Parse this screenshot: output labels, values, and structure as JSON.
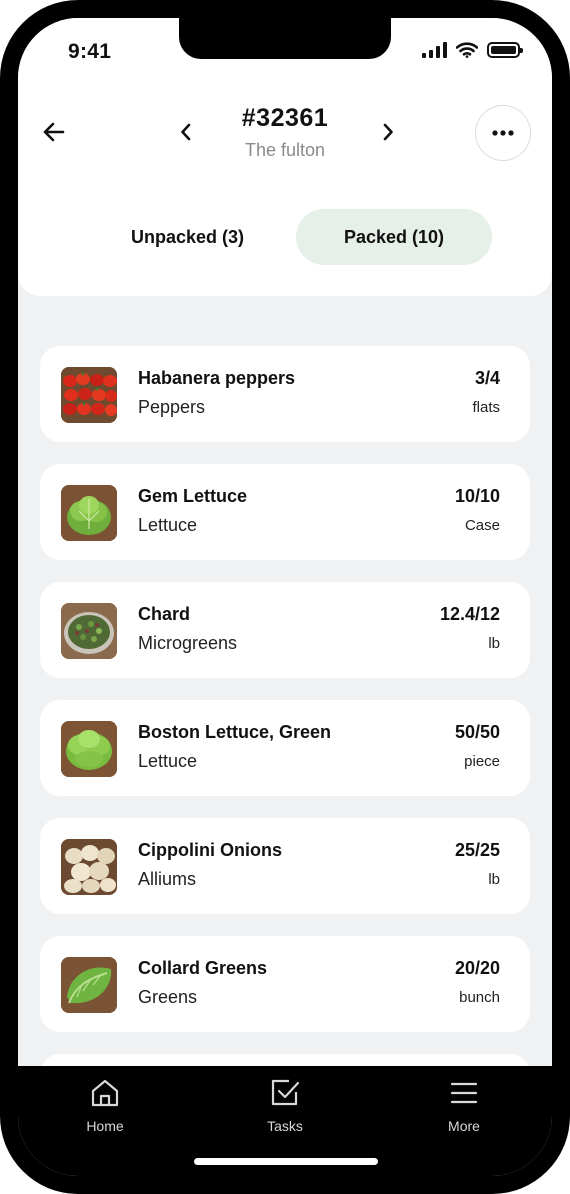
{
  "status_bar": {
    "time": "9:41"
  },
  "header": {
    "order_number": "#32361",
    "customer": "The fulton"
  },
  "tabs": [
    {
      "label": "Unpacked (3)",
      "selected": false
    },
    {
      "label": "Packed (10)",
      "selected": true
    }
  ],
  "items": [
    {
      "name": "Habanera peppers",
      "category": "Peppers",
      "quantity": "3/4",
      "unit": "flats",
      "image": "red-peppers"
    },
    {
      "name": "Gem Lettuce",
      "category": "Lettuce",
      "quantity": "10/10",
      "unit": "Case",
      "image": "lettuce-head"
    },
    {
      "name": "Chard",
      "category": "Microgreens",
      "quantity": "12.4/12",
      "unit": "lb",
      "image": "microgreens-bowl"
    },
    {
      "name": "Boston Lettuce, Green",
      "category": "Lettuce",
      "quantity": "50/50",
      "unit": "piece",
      "image": "lettuce-head"
    },
    {
      "name": "Cippolini Onions",
      "category": "Alliums",
      "quantity": "25/25",
      "unit": "lb",
      "image": "onions"
    },
    {
      "name": "Collard Greens",
      "category": "Greens",
      "quantity": "20/20",
      "unit": "bunch",
      "image": "greens-leaves"
    }
  ],
  "bottom_nav": [
    {
      "label": "Home",
      "icon": "home-icon"
    },
    {
      "label": "Tasks",
      "icon": "checkbox-icon"
    },
    {
      "label": "More",
      "icon": "menu-icon"
    }
  ],
  "colors": {
    "background": "#f0f1f2",
    "selected_tab": "#e6efe8",
    "nav_background": "#000000"
  }
}
